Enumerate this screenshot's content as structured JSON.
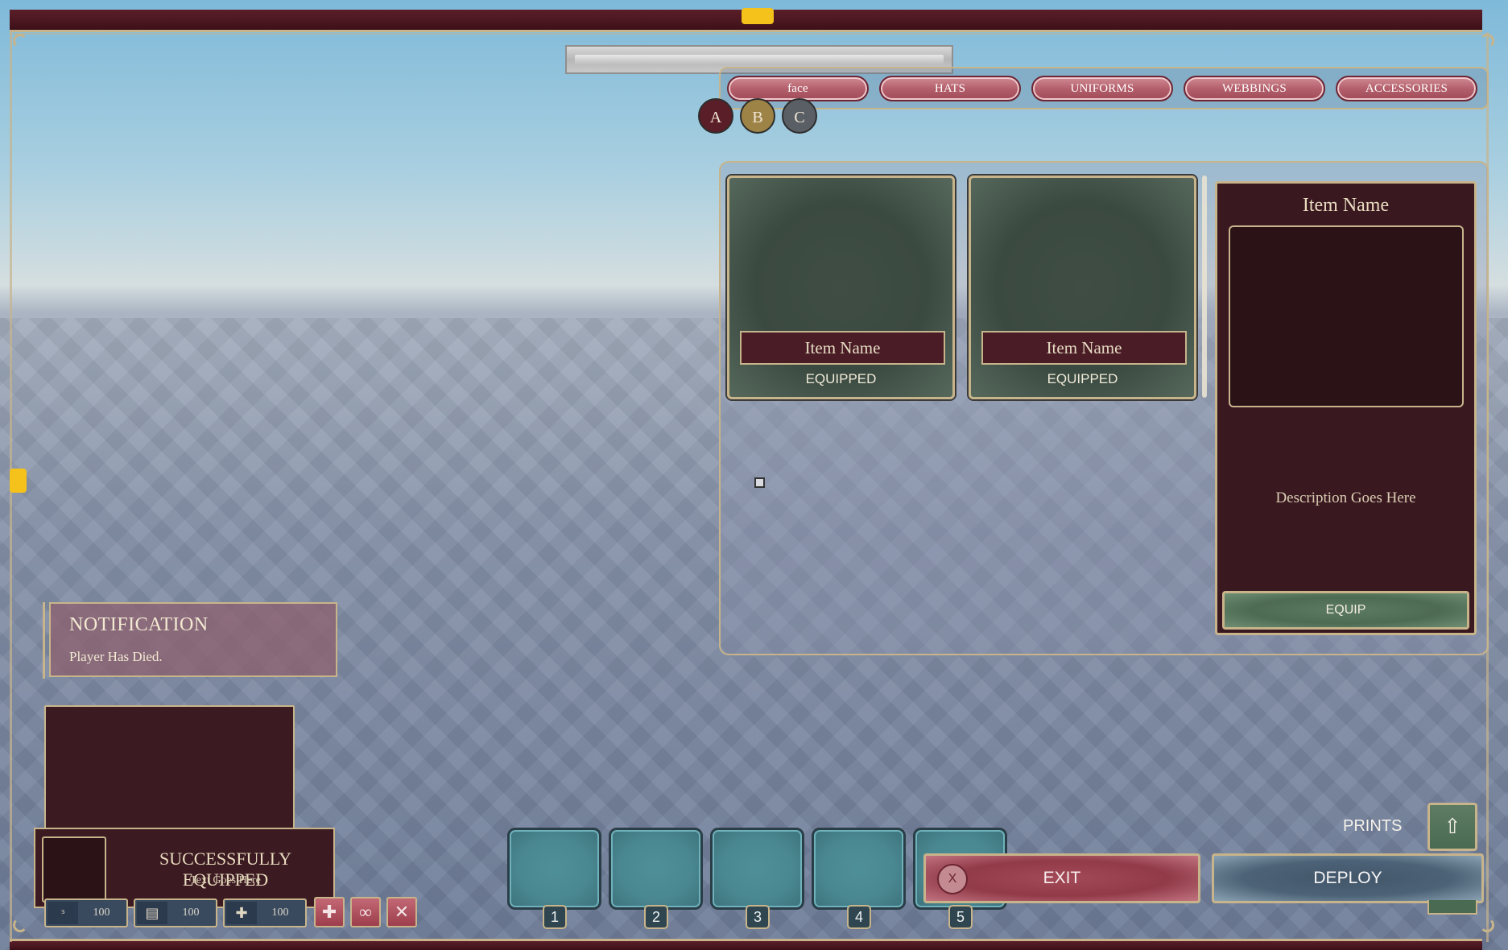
{
  "colors": {
    "frame_maroon": "#4a1620",
    "gold_border": "#c7b48b",
    "card_green": "#3f4d45",
    "slot_teal": "#4f8f98",
    "tab_pink": "#b4606c"
  },
  "category_tabs": [
    "face",
    "HATS",
    "UNIFORMS",
    "WEBBINGS",
    "ACCESSORIES"
  ],
  "variant_buttons": [
    "A",
    "B",
    "C"
  ],
  "inventory": {
    "items": [
      {
        "name": "Item Name",
        "status": "EQUIPPED"
      },
      {
        "name": "Item Name",
        "status": "EQUIPPED"
      }
    ]
  },
  "detail": {
    "title": "Item Name",
    "description": "Description Goes Here",
    "equip_label": "EQUIP"
  },
  "notification": {
    "title": "NOTIFICATION",
    "text": "Player Has Died."
  },
  "toast": {
    "title": "SUCCESSFULLY EQUIPPED",
    "text": "Text Goes Here"
  },
  "stats": [
    {
      "icon": "bank-icon",
      "value": "100"
    },
    {
      "icon": "money-icon",
      "value": "100"
    },
    {
      "icon": "health-icon",
      "value": "100"
    }
  ],
  "hotbar": [
    "1",
    "2",
    "3",
    "4",
    "5"
  ],
  "actions": {
    "exit_label": "EXIT",
    "exit_icon_text": "X",
    "deploy_label": "DEPLOY",
    "prints_label": "PRINTS"
  }
}
